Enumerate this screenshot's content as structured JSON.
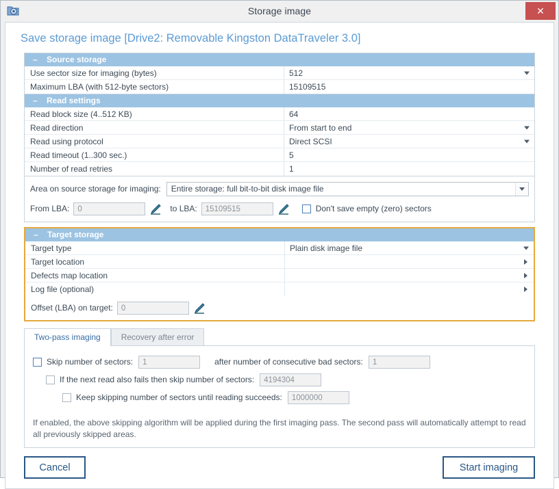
{
  "window": {
    "title": "Storage image",
    "app_icon": "disk-image-icon",
    "close_label": "✕"
  },
  "page_title": "Save storage image [Drive2: Removable Kingston DataTraveler 3.0]",
  "colors": {
    "accent_blue": "#5b9bd5",
    "group_header_bg": "#9cc3e2",
    "highlight_border": "#e5a93b",
    "button_border": "#2a5785",
    "close_button_bg": "#c75050"
  },
  "source_storage": {
    "header": "Source storage",
    "collapse_glyph": "–",
    "rows": [
      {
        "label": "Use sector size for imaging (bytes)",
        "value": "512",
        "control": "dropdown"
      },
      {
        "label": "Maximum LBA (with 512-byte sectors)",
        "value": "15109515",
        "control": "text"
      }
    ]
  },
  "read_settings": {
    "header": "Read settings",
    "collapse_glyph": "–",
    "rows": [
      {
        "label": "Read block size (4..512 KB)",
        "value": "64",
        "control": "text"
      },
      {
        "label": "Read direction",
        "value": "From start to end",
        "control": "dropdown"
      },
      {
        "label": "Read using protocol",
        "value": "Direct SCSI",
        "control": "dropdown"
      },
      {
        "label": "Read timeout (1..300 sec.)",
        "value": "5",
        "control": "text"
      },
      {
        "label": "Number of read retries",
        "value": "1",
        "control": "text"
      }
    ]
  },
  "area_section": {
    "area_label": "Area on source storage for imaging:",
    "area_value": "Entire storage: full bit-to-bit disk image file",
    "from_lba_label": "From LBA:",
    "from_lba_value": "0",
    "to_lba_label": "to LBA:",
    "to_lba_value": "15109515",
    "dont_save_empty_label": "Don't save empty (zero) sectors",
    "dont_save_empty_checked": false
  },
  "target_storage": {
    "header": "Target storage",
    "collapse_glyph": "–",
    "rows": [
      {
        "label": "Target type",
        "value": "Plain disk image file",
        "control": "dropdown"
      },
      {
        "label": "Target location",
        "value": "",
        "control": "browse"
      },
      {
        "label": "Defects map location",
        "value": "",
        "control": "browse"
      },
      {
        "label": "Log file (optional)",
        "value": "",
        "control": "browse"
      }
    ],
    "offset_label": "Offset (LBA) on target:",
    "offset_value": "0"
  },
  "tabs": [
    {
      "label": "Two-pass imaging",
      "active": true
    },
    {
      "label": "Recovery after error",
      "active": false
    }
  ],
  "two_pass": {
    "skip_label": "Skip number of sectors:",
    "skip_value": "1",
    "skip_checked": false,
    "after_label": "after number of consecutive bad sectors:",
    "after_value": "1",
    "next_read_label": "If the next read also fails then skip number of sectors:",
    "next_read_value": "4194304",
    "next_read_checked": false,
    "keep_skipping_label": "Keep skipping number of sectors until reading succeeds:",
    "keep_skipping_value": "1000000",
    "keep_skipping_checked": false,
    "help_text": "If enabled, the above skipping algorithm will be applied during the first imaging pass. The second pass will automatically attempt to read all previously skipped areas."
  },
  "footer": {
    "cancel_label": "Cancel",
    "start_label": "Start imaging"
  }
}
